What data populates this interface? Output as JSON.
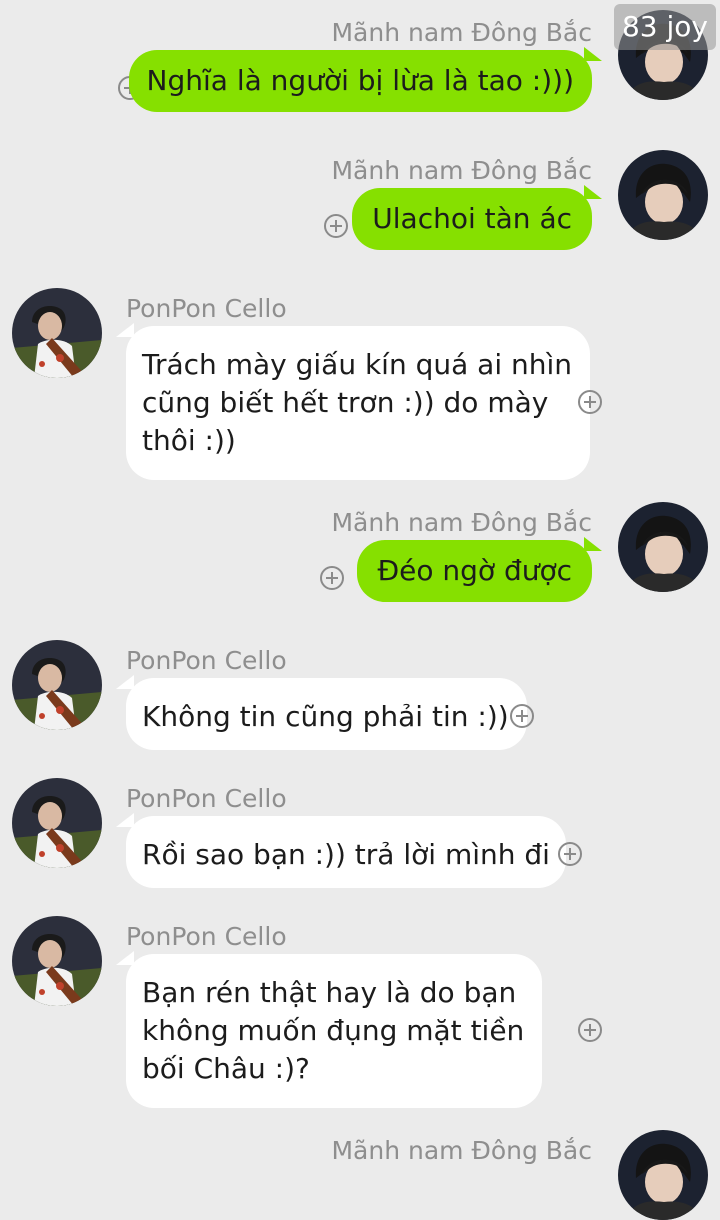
{
  "watermark": "83 joy",
  "messages": [
    {
      "sender": "Mãnh nam Đông Bắc",
      "side": "right",
      "lines": [
        "Nghĩa là người bị lừa là tao :)))"
      ]
    },
    {
      "sender": "Mãnh nam Đông Bắc",
      "side": "right",
      "lines": [
        "Ulachoi tàn ác"
      ]
    },
    {
      "sender": "PonPon Cello",
      "side": "left",
      "lines": [
        "Trách mày giấu kín quá ai nhìn",
        "cũng biết hết trơn :)) do mày",
        "thôi :))"
      ]
    },
    {
      "sender": "Mãnh nam Đông Bắc",
      "side": "right",
      "lines": [
        "Đéo ngờ được"
      ]
    },
    {
      "sender": "PonPon Cello",
      "side": "left",
      "lines": [
        "Không tin cũng phải tin :))"
      ]
    },
    {
      "sender": "PonPon Cello",
      "side": "left",
      "lines": [
        "Rồi sao bạn :)) trả lời mình đi"
      ]
    },
    {
      "sender": "PonPon Cello",
      "side": "left",
      "lines": [
        "Bạn rén thật hay là do bạn",
        "không muốn đụng mặt tiền",
        "bối Châu :)?"
      ]
    },
    {
      "sender": "Mãnh nam Đông Bắc",
      "side": "right",
      "lines": []
    }
  ],
  "colors": {
    "outgoing_bubble": "#86e000",
    "incoming_bubble": "#ffffff",
    "background": "#ebebeb",
    "sender_name": "#8e8e8e"
  },
  "icons": {
    "message_action": "plus-circle-icon"
  }
}
